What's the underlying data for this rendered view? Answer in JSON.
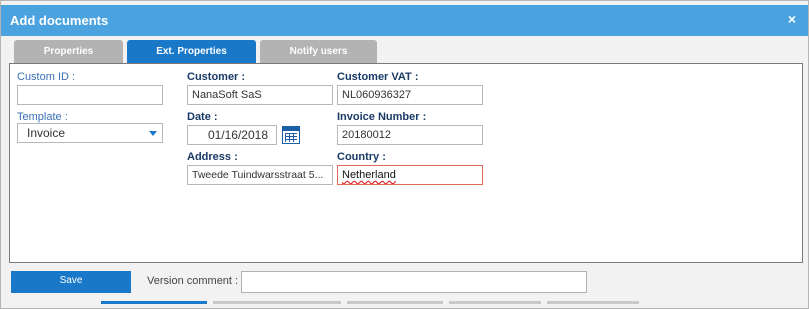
{
  "dialog": {
    "title": "Add documents",
    "close_icon": "×"
  },
  "tabs": [
    {
      "label": "Properties",
      "active": false
    },
    {
      "label": "Ext. Properties",
      "active": true
    },
    {
      "label": "Notify users",
      "active": false
    }
  ],
  "form": {
    "custom_id": {
      "label": "Custom ID :",
      "value": ""
    },
    "template": {
      "label": "Template :",
      "value": "Invoice"
    },
    "customer": {
      "label": "Customer :",
      "value": "NanaSoft SaS"
    },
    "date": {
      "label": "Date :",
      "value": "01/16/2018"
    },
    "address": {
      "label": "Address :",
      "value": "Tweede Tuindwarsstraat 5..."
    },
    "customer_vat": {
      "label": "Customer VAT :",
      "value": "NL060936327"
    },
    "invoice_number": {
      "label": "Invoice Number :",
      "value": "20180012"
    },
    "country": {
      "label": "Country :",
      "value": "Netherland"
    }
  },
  "footer": {
    "save_label": "Save",
    "version_comment_label": "Version comment :",
    "version_comment_value": ""
  },
  "colors": {
    "title_bar": "#4aa3df",
    "accent": "#1a78c9",
    "error_border": "#e06c5a"
  }
}
